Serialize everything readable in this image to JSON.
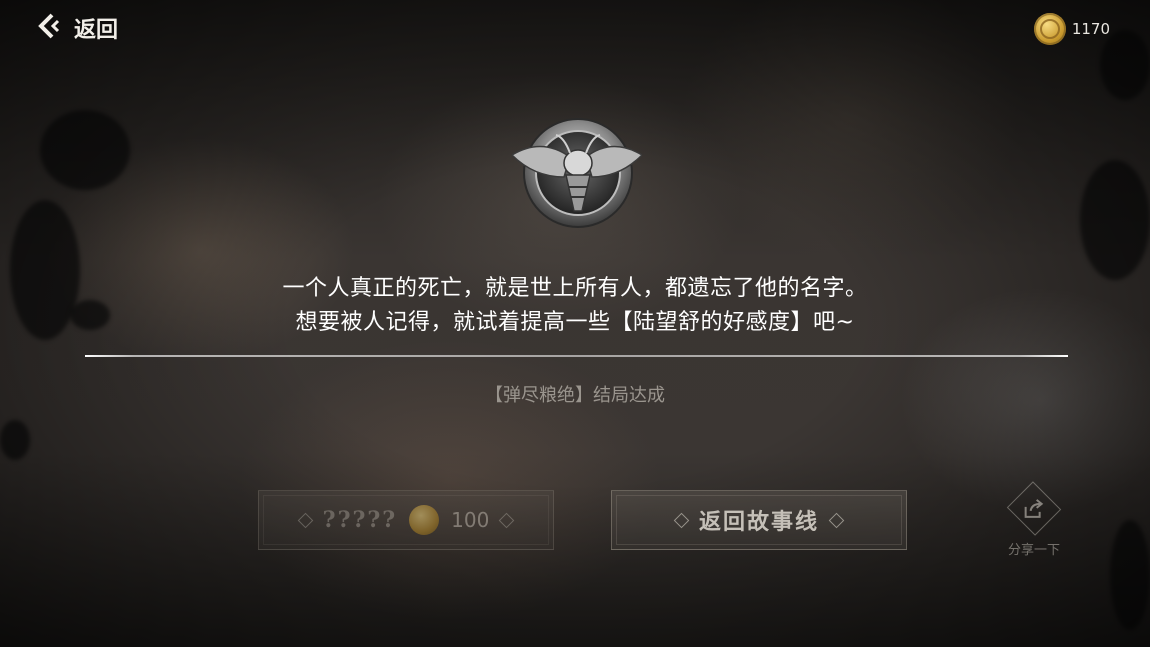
{
  "header": {
    "back_label": "返回",
    "back_icon": "chevron-left-icon",
    "coin_icon": "gold-coin-icon",
    "coin_count": "1170"
  },
  "badge": {
    "icon": "bee-emblem-icon"
  },
  "message": {
    "line1": "一个人真正的死亡，就是世上所有人，都遗忘了他的名字。",
    "line2": "想要被人记得，就试着提高一些【陆望舒的好感度】吧~"
  },
  "ending_text": "【弹尽粮绝】结局达成",
  "buttons": {
    "replay_label": "?????",
    "replay_cost": "100",
    "story_label": "返回故事线"
  },
  "share": {
    "label": "分享一下",
    "icon": "share-icon"
  },
  "colors": {
    "accent": "#d4a63a",
    "text": "#ffffff",
    "muted": "#9a958e"
  }
}
